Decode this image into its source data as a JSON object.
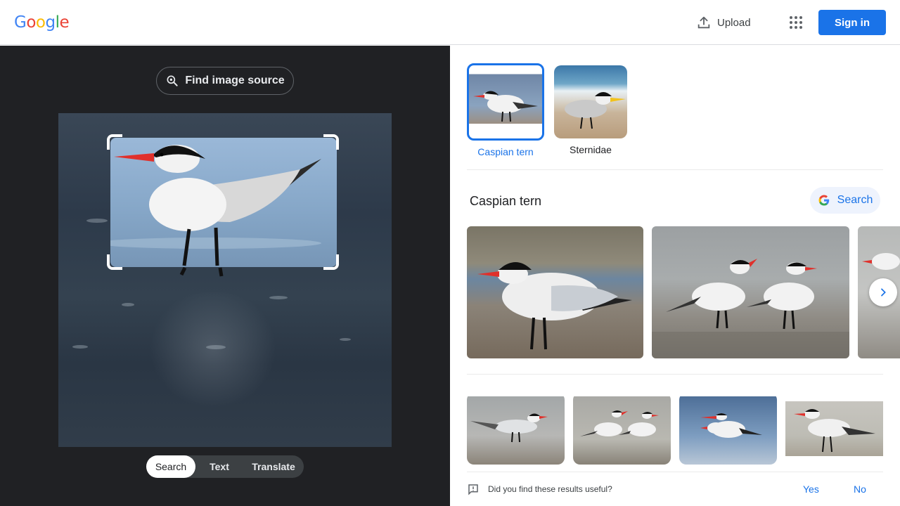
{
  "header": {
    "logo_letters": [
      "G",
      "o",
      "o",
      "g",
      "l",
      "e"
    ],
    "logo_colors": [
      "#4285F4",
      "#EA4335",
      "#FBBC05",
      "#4285F4",
      "#34A853",
      "#EA4335"
    ],
    "upload_label": "Upload",
    "sign_in_label": "Sign in"
  },
  "left_panel": {
    "find_source_label": "Find image source",
    "modes": [
      {
        "label": "Search",
        "active": true
      },
      {
        "label": "Text",
        "active": false
      },
      {
        "label": "Translate",
        "active": false
      }
    ]
  },
  "right_panel": {
    "chips": [
      {
        "label": "Caspian tern",
        "selected": true
      },
      {
        "label": "Sternidae",
        "selected": false
      }
    ],
    "section_title": "Caspian tern",
    "search_button_label": "Search",
    "feedback": {
      "question": "Did you find these results useful?",
      "yes_label": "Yes",
      "no_label": "No"
    }
  },
  "colors": {
    "accent": "#1a73e8",
    "left_bg": "#202124"
  },
  "icons": [
    "upload-icon",
    "apps-grid-icon",
    "lens-search-icon",
    "google-g-icon",
    "chevron-right-icon",
    "feedback-icon"
  ]
}
